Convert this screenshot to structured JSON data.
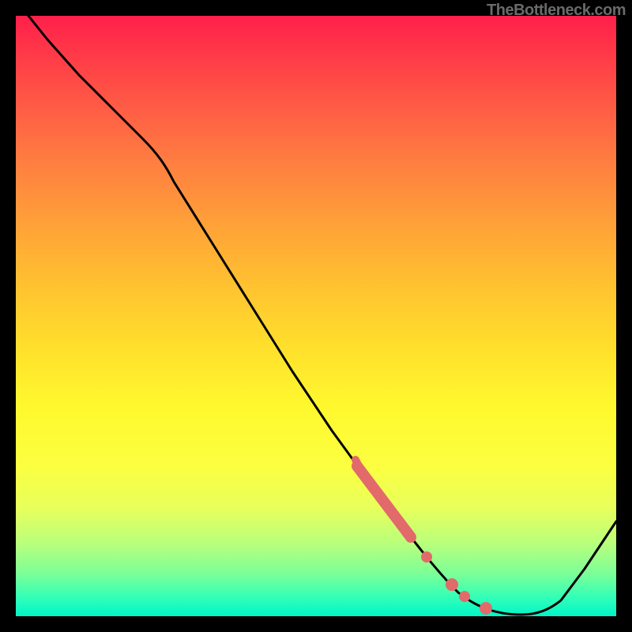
{
  "watermark": "TheBottleneck.com",
  "chart_data": {
    "type": "line",
    "title": "",
    "xlabel": "",
    "ylabel": "",
    "xlim": [
      0,
      100
    ],
    "ylim": [
      0,
      100
    ],
    "grid": false,
    "series": [
      {
        "name": "bottleneck-curve",
        "color": "#000000",
        "x": [
          0,
          5,
          10,
          15,
          20,
          25,
          30,
          35,
          40,
          45,
          50,
          55,
          60,
          63,
          66,
          70,
          74,
          78,
          82,
          86,
          90,
          95,
          100
        ],
        "y": [
          100,
          95,
          90,
          85,
          80,
          74,
          67,
          60,
          53,
          46,
          39,
          32,
          25,
          20,
          15,
          10,
          6,
          3,
          1,
          1,
          4,
          10,
          18
        ]
      }
    ],
    "markers": [
      {
        "name": "highlight-band",
        "color": "#e26a6a",
        "x_start": 56,
        "x_end": 66,
        "style": "thick-along-curve"
      },
      {
        "name": "highlight-dot-1",
        "color": "#e26a6a",
        "x": 68,
        "style": "dot"
      },
      {
        "name": "highlight-dot-2",
        "color": "#e26a6a",
        "x": 72,
        "style": "dot"
      },
      {
        "name": "highlight-dot-3",
        "color": "#e26a6a",
        "x": 74,
        "style": "dot"
      },
      {
        "name": "highlight-dot-4",
        "color": "#e26a6a",
        "x": 77,
        "style": "dot"
      }
    ],
    "gradient_stops": [
      {
        "pct": 0,
        "color": "#ff1f4a"
      },
      {
        "pct": 15,
        "color": "#ff5b45"
      },
      {
        "pct": 35,
        "color": "#ffa238"
      },
      {
        "pct": 55,
        "color": "#ffdf2c"
      },
      {
        "pct": 75,
        "color": "#fbff40"
      },
      {
        "pct": 93,
        "color": "#7aff98"
      },
      {
        "pct": 100,
        "color": "#00f5c8"
      }
    ]
  }
}
